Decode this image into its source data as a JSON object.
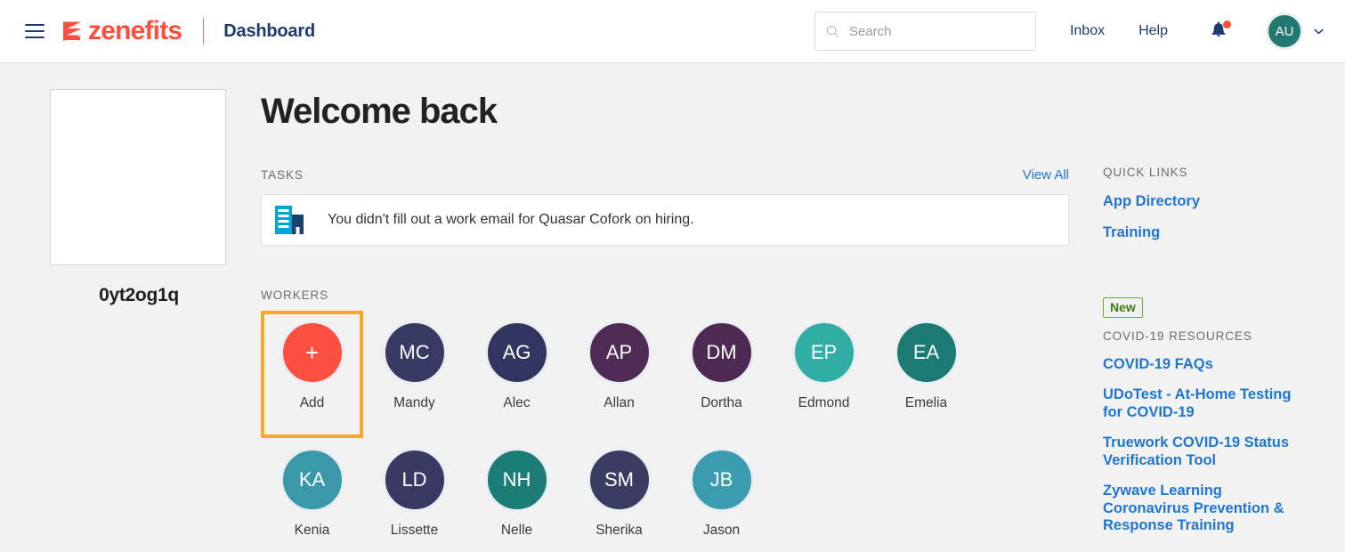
{
  "header": {
    "menu_icon": "hamburger-icon",
    "logo_text": "zenefits",
    "logo_mark": "zenefits-z-icon",
    "page_title": "Dashboard",
    "search": {
      "icon": "search-icon",
      "value": "",
      "placeholder": "Search"
    },
    "nav": [
      {
        "label": "Inbox",
        "name": "inbox"
      },
      {
        "label": "Help",
        "name": "help"
      }
    ],
    "bell_icon": "bell-icon",
    "bell_has_notification": true,
    "avatar_initials": "AU",
    "avatar_color": "#22796f",
    "chevron_icon": "chevron-down-icon"
  },
  "profile": {
    "photo_alt": "profile-photo-placeholder",
    "name": "0yt2og1q"
  },
  "main": {
    "welcome_title": "Welcome back",
    "tasks_label": "TASKS",
    "view_all_label": "View All",
    "task": {
      "icon": "buildings-icon",
      "text": "You didn't fill out a work email for Quasar Cofork on hiring."
    },
    "workers_label": "WORKERS",
    "workers": [
      {
        "initials": "+",
        "name": "Add",
        "color": "#fb5040",
        "highlighted": true
      },
      {
        "initials": "MC",
        "name": "Mandy",
        "color": "#373a63",
        "highlighted": false
      },
      {
        "initials": "AG",
        "name": "Alec",
        "color": "#32355f",
        "highlighted": false
      },
      {
        "initials": "AP",
        "name": "Allan",
        "color": "#4f2b55",
        "highlighted": false
      },
      {
        "initials": "DM",
        "name": "Dortha",
        "color": "#4e2a53",
        "highlighted": false
      },
      {
        "initials": "EP",
        "name": "Edmond",
        "color": "#32ada5",
        "highlighted": false
      },
      {
        "initials": "EA",
        "name": "Emelia",
        "color": "#1b7a73",
        "highlighted": false
      },
      {
        "initials": "KA",
        "name": "Kenia",
        "color": "#3b98aa",
        "highlighted": false
      },
      {
        "initials": "LD",
        "name": "Lissette",
        "color": "#383a63",
        "highlighted": false
      },
      {
        "initials": "NH",
        "name": "Nelle",
        "color": "#1b7d75",
        "highlighted": false
      },
      {
        "initials": "SM",
        "name": "Sherika",
        "color": "#3a3c62",
        "highlighted": false
      },
      {
        "initials": "JB",
        "name": "Jason",
        "color": "#3a9cae",
        "highlighted": false
      }
    ],
    "highlight_color": "#f8a825"
  },
  "sidebar": {
    "quick_links_label": "QUICK LINKS",
    "quick_links": [
      {
        "label": "App Directory"
      },
      {
        "label": "Training"
      }
    ],
    "new_badge": "New",
    "covid_label": "COVID-19 RESOURCES",
    "covid_links": [
      {
        "label": "COVID-19 FAQs"
      },
      {
        "label": "UDoTest - At-Home Testing for COVID-19"
      },
      {
        "label": "Truework COVID-19 Status Verification Tool"
      },
      {
        "label": "Zywave Learning Coronavirus Prevention & Response Training"
      }
    ]
  },
  "colors": {
    "brand_red": "#fb5040",
    "navy": "#1e3a6e",
    "link_blue": "#2176d2",
    "page_bg": "#f2f2f2",
    "badge_green": "#6cae2e"
  }
}
